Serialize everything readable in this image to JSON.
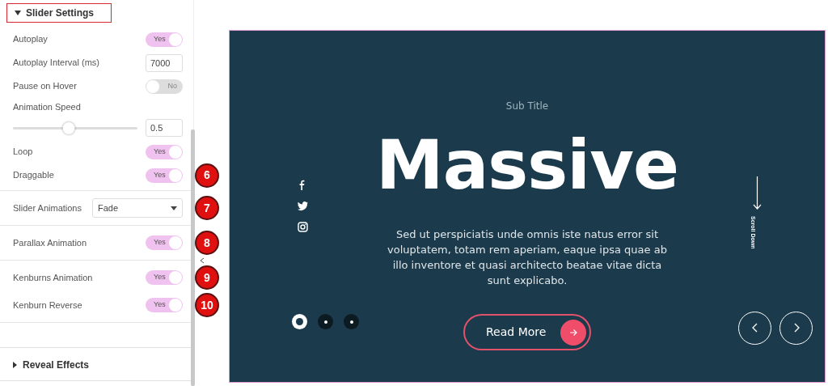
{
  "panel": {
    "header": {
      "title": "Slider Settings",
      "expanded": true
    },
    "groups": [
      {
        "items": [
          {
            "kind": "toggle",
            "label": "Autoplay",
            "on": true,
            "text": "Yes"
          },
          {
            "kind": "number",
            "label": "Autoplay Interval (ms)",
            "value": "7000"
          },
          {
            "kind": "toggle",
            "label": "Pause on Hover",
            "on": false,
            "text": "No"
          },
          {
            "kind": "slider",
            "label": "Animation Speed",
            "level": 0.45,
            "value": "0.5"
          },
          {
            "kind": "toggle",
            "label": "Loop",
            "on": true,
            "text": "Yes"
          },
          {
            "kind": "toggle",
            "label": "Draggable",
            "on": true,
            "text": "Yes",
            "badge": "6"
          }
        ]
      },
      {
        "items": [
          {
            "kind": "select",
            "label": "Slider Animations",
            "value": "Fade",
            "badge": "7"
          }
        ]
      },
      {
        "items": [
          {
            "kind": "toggle",
            "label": "Parallax Animation",
            "on": true,
            "text": "Yes",
            "badge": "8"
          }
        ]
      },
      {
        "items": [
          {
            "kind": "toggle",
            "label": "Kenburns Animation",
            "on": true,
            "text": "Yes",
            "badge": "9"
          },
          {
            "kind": "toggle",
            "label": "Kenburn Reverse",
            "on": true,
            "text": "Yes",
            "badge": "10"
          }
        ]
      }
    ],
    "section": {
      "title": "Reveal Effects",
      "expanded": false
    }
  },
  "slide": {
    "subtitle": "Sub Title",
    "title": "Massive",
    "description": "Sed ut perspiciatis unde omnis iste natus error sit voluptatem, totam rem aperiam, eaque ipsa quae ab illo inventore et quasi architecto beatae vitae dicta sunt explicabo.",
    "social": [
      {
        "kind": "facebook"
      },
      {
        "kind": "twitter"
      },
      {
        "kind": "instagram"
      }
    ],
    "dots": [
      {
        "selected": true
      },
      {
        "selected": false
      },
      {
        "selected": false
      }
    ],
    "button": "Read More",
    "scroll_label": "Scroll Down"
  }
}
